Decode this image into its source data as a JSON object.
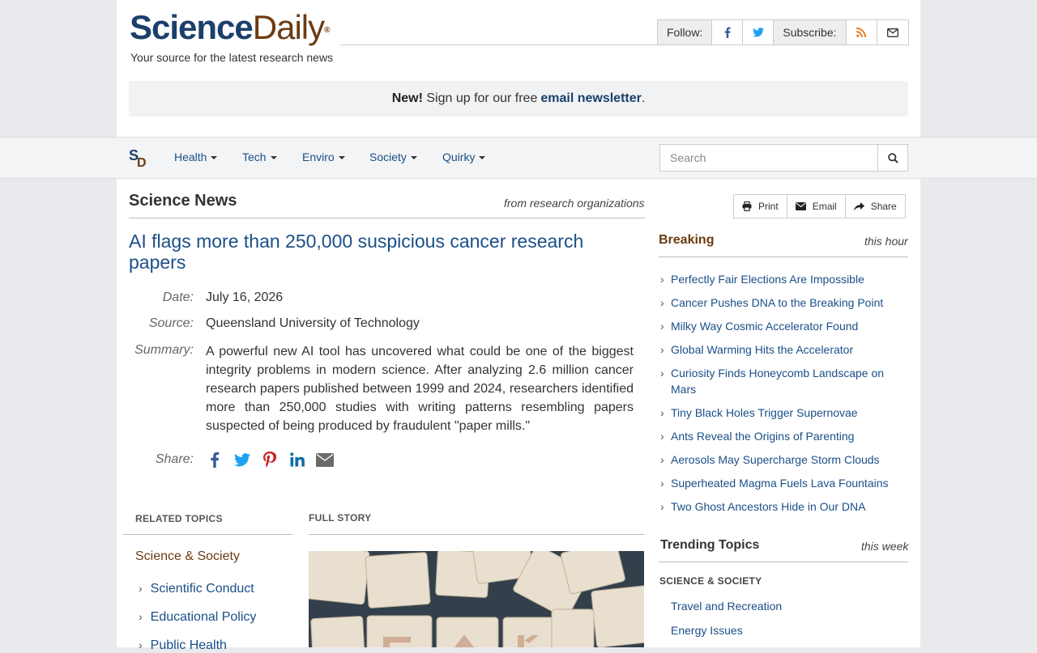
{
  "brand": {
    "name_part1": "Science",
    "name_part2": "Daily",
    "registered": "®",
    "tagline": "Your source for the latest research news"
  },
  "social": {
    "follow_label": "Follow:",
    "subscribe_label": "Subscribe:",
    "icons": [
      "facebook-icon",
      "twitter-icon",
      "rss-icon",
      "email-icon"
    ]
  },
  "newsletter": {
    "new_label": "New!",
    "text": "Sign up for our free",
    "link_text": "email newsletter",
    "suffix": "."
  },
  "nav": {
    "logo_s": "S",
    "logo_d": "D",
    "items": [
      {
        "label": "Health"
      },
      {
        "label": "Tech"
      },
      {
        "label": "Enviro"
      },
      {
        "label": "Society"
      },
      {
        "label": "Quirky"
      }
    ],
    "search_placeholder": "Search"
  },
  "main": {
    "section_title": "Science News",
    "section_subtitle": "from research organizations",
    "headline": "AI flags more than 250,000 suspicious cancer research papers",
    "date_label": "Date:",
    "date": "July 16, 2026",
    "source_label": "Source:",
    "source": "Queensland University of Technology",
    "summary_label": "Summary:",
    "summary": "A powerful new AI tool has uncovered what could be one of the biggest integrity problems in modern science. After analyzing 2.6 million cancer research papers published between 1999 and 2024, researchers identified more than 250,000 studies with writing patterns resembling papers suspected of being produced by fraudulent \"paper mills.\"",
    "share_label": "Share:"
  },
  "related": {
    "heading": "RELATED TOPICS",
    "category": "Science & Society",
    "topics": [
      "Scientific Conduct",
      "Educational Policy",
      "Public Health"
    ]
  },
  "full_story": {
    "heading": "FULL STORY"
  },
  "tools": {
    "print": "Print",
    "email": "Email",
    "share": "Share"
  },
  "breaking": {
    "title": "Breaking",
    "subtitle": "this hour",
    "items": [
      "Perfectly Fair Elections Are Impossible",
      "Cancer Pushes DNA to the Breaking Point",
      "Milky Way Cosmic Accelerator Found",
      "Global Warming Hits the Accelerator",
      "Curiosity Finds Honeycomb Landscape on Mars",
      "Tiny Black Holes Trigger Supernovae",
      "Ants Reveal the Origins of Parenting",
      "Aerosols May Supercharge Storm Clouds",
      "Superheated Magma Fuels Lava Fountains",
      "Two Ghost Ancestors Hide in Our DNA"
    ]
  },
  "trending": {
    "title": "Trending Topics",
    "subtitle": "this week",
    "category": "SCIENCE & SOCIETY",
    "items": [
      "Travel and Recreation",
      "Energy Issues"
    ]
  },
  "colors": {
    "brand_blue": "#1b3f6b",
    "brand_brown": "#6b3b12",
    "link_blue": "#1b4f88"
  }
}
